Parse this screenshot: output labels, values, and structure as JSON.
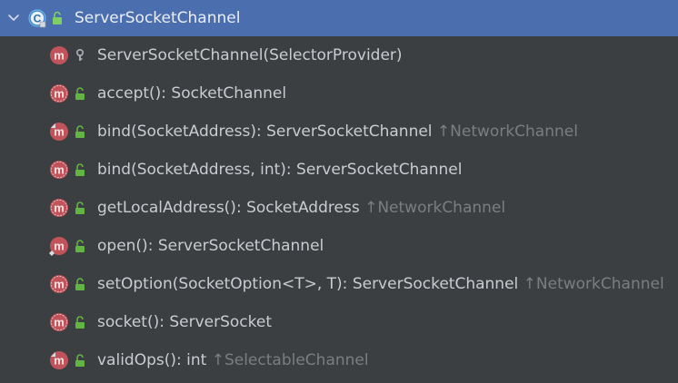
{
  "header": {
    "title": "ServerSocketChannel",
    "class_icon_letter": "C",
    "expanded": true
  },
  "colors": {
    "selection": "#4b6eaf",
    "background": "#3c3f41",
    "method_badge": "#c1545a",
    "lock_green": "#62b543",
    "text": "#c9ccd0",
    "inherited_text": "#7b7e80"
  },
  "members": [
    {
      "signature": "ServerSocketChannel(SelectorProvider)",
      "inherited": "",
      "visibility": "protected",
      "icon": "method",
      "abstract": false,
      "static": false,
      "overrides": false
    },
    {
      "signature": "accept(): SocketChannel",
      "inherited": "",
      "visibility": "public",
      "icon": "method",
      "abstract": true,
      "static": false,
      "overrides": false
    },
    {
      "signature": "bind(SocketAddress): ServerSocketChannel",
      "inherited": "↑NetworkChannel",
      "visibility": "public",
      "icon": "method",
      "abstract": false,
      "static": false,
      "overrides": true
    },
    {
      "signature": "bind(SocketAddress, int): ServerSocketChannel",
      "inherited": "",
      "visibility": "public",
      "icon": "method",
      "abstract": true,
      "static": false,
      "overrides": false
    },
    {
      "signature": "getLocalAddress(): SocketAddress",
      "inherited": "↑NetworkChannel",
      "visibility": "public",
      "icon": "method",
      "abstract": true,
      "static": false,
      "overrides": false
    },
    {
      "signature": "open(): ServerSocketChannel",
      "inherited": "",
      "visibility": "public",
      "icon": "method",
      "abstract": false,
      "static": true,
      "overrides": false
    },
    {
      "signature": "setOption(SocketOption<T>, T): ServerSocketChannel",
      "inherited": "↑NetworkChannel",
      "visibility": "public",
      "icon": "method",
      "abstract": true,
      "static": false,
      "overrides": false
    },
    {
      "signature": "socket(): ServerSocket",
      "inherited": "",
      "visibility": "public",
      "icon": "method",
      "abstract": true,
      "static": false,
      "overrides": false
    },
    {
      "signature": "validOps(): int",
      "inherited": "↑SelectableChannel",
      "visibility": "public",
      "icon": "method",
      "abstract": false,
      "static": false,
      "overrides": true
    }
  ]
}
